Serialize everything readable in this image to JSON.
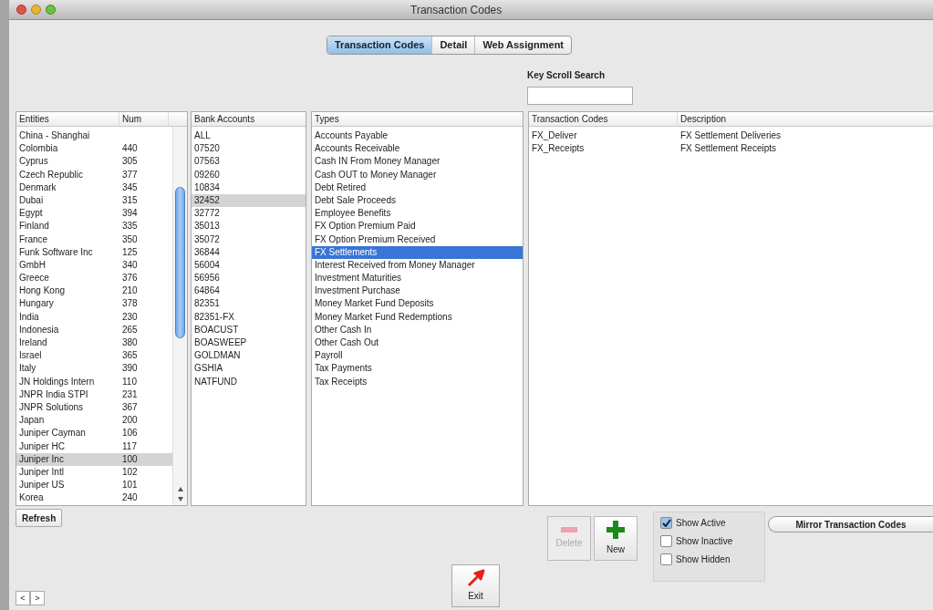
{
  "window": {
    "title": "Transaction Codes"
  },
  "tabs": [
    {
      "label": "Transaction Codes",
      "selected": true
    },
    {
      "label": "Detail",
      "selected": false
    },
    {
      "label": "Web Assignment",
      "selected": false
    }
  ],
  "search": {
    "label": "Key Scroll Search"
  },
  "entities": {
    "columns": [
      "Entities",
      "Num"
    ],
    "rows": [
      {
        "name": "China - Shanghai",
        "num": "",
        "selected": false
      },
      {
        "name": "Colombia",
        "num": "440",
        "selected": false
      },
      {
        "name": "Cyprus",
        "num": "305",
        "selected": false
      },
      {
        "name": "Czech Republic",
        "num": "377",
        "selected": false
      },
      {
        "name": "Denmark",
        "num": "345",
        "selected": false
      },
      {
        "name": "Dubai",
        "num": "315",
        "selected": false
      },
      {
        "name": "Egypt",
        "num": "394",
        "selected": false
      },
      {
        "name": "Finland",
        "num": "335",
        "selected": false
      },
      {
        "name": "France",
        "num": "350",
        "selected": false
      },
      {
        "name": "Funk Software Inc",
        "num": "125",
        "selected": false
      },
      {
        "name": "GmbH",
        "num": "340",
        "selected": false
      },
      {
        "name": "Greece",
        "num": "376",
        "selected": false
      },
      {
        "name": "Hong Kong",
        "num": "210",
        "selected": false
      },
      {
        "name": "Hungary",
        "num": "378",
        "selected": false
      },
      {
        "name": "India",
        "num": "230",
        "selected": false
      },
      {
        "name": "Indonesia",
        "num": "265",
        "selected": false
      },
      {
        "name": "Ireland",
        "num": "380",
        "selected": false
      },
      {
        "name": "Israel",
        "num": "365",
        "selected": false
      },
      {
        "name": "Italy",
        "num": "390",
        "selected": false
      },
      {
        "name": "JN Holdings Intern",
        "num": "110",
        "selected": false
      },
      {
        "name": "JNPR India STPI",
        "num": "231",
        "selected": false
      },
      {
        "name": "JNPR Solutions",
        "num": "367",
        "selected": false
      },
      {
        "name": "Japan",
        "num": "200",
        "selected": false
      },
      {
        "name": "Juniper Cayman",
        "num": "106",
        "selected": false
      },
      {
        "name": "Juniper HC",
        "num": "117",
        "selected": false
      },
      {
        "name": "Juniper Inc",
        "num": "100",
        "selected": true
      },
      {
        "name": "Juniper Intl",
        "num": "102",
        "selected": false
      },
      {
        "name": "Juniper US",
        "num": "101",
        "selected": false
      },
      {
        "name": "Korea",
        "num": "240",
        "selected": false
      }
    ]
  },
  "bank_accounts": {
    "column": "Bank Accounts",
    "rows": [
      {
        "label": "ALL",
        "selected": false
      },
      {
        "label": "07520",
        "selected": false
      },
      {
        "label": "07563",
        "selected": false
      },
      {
        "label": "09260",
        "selected": false
      },
      {
        "label": "10834",
        "selected": false
      },
      {
        "label": "32452",
        "selected": true
      },
      {
        "label": "32772",
        "selected": false
      },
      {
        "label": "35013",
        "selected": false
      },
      {
        "label": "35072",
        "selected": false
      },
      {
        "label": "36844",
        "selected": false
      },
      {
        "label": "56004",
        "selected": false
      },
      {
        "label": "56956",
        "selected": false
      },
      {
        "label": "64864",
        "selected": false
      },
      {
        "label": "82351",
        "selected": false
      },
      {
        "label": "82351-FX",
        "selected": false
      },
      {
        "label": "BOACUST",
        "selected": false
      },
      {
        "label": "BOASWEEP",
        "selected": false
      },
      {
        "label": "GOLDMAN",
        "selected": false
      },
      {
        "label": "GSHIA",
        "selected": false
      },
      {
        "label": "NATFUND",
        "selected": false
      }
    ]
  },
  "types": {
    "column": "Types",
    "rows": [
      {
        "label": "Accounts Payable",
        "selected": false
      },
      {
        "label": "Accounts Receivable",
        "selected": false
      },
      {
        "label": "Cash IN From Money Manager",
        "selected": false
      },
      {
        "label": "Cash OUT to Money Manager",
        "selected": false
      },
      {
        "label": "Debt Retired",
        "selected": false
      },
      {
        "label": "Debt Sale Proceeds",
        "selected": false
      },
      {
        "label": "Employee Benefits",
        "selected": false
      },
      {
        "label": "FX Option Premium Paid",
        "selected": false
      },
      {
        "label": "FX Option Premium Received",
        "selected": false
      },
      {
        "label": "FX Settlements",
        "selected": true
      },
      {
        "label": "Interest Received from Money Manager",
        "selected": false
      },
      {
        "label": "Investment Maturities",
        "selected": false
      },
      {
        "label": "Investment Purchase",
        "selected": false
      },
      {
        "label": "Money Market Fund Deposits",
        "selected": false
      },
      {
        "label": "Money Market Fund Redemptions",
        "selected": false
      },
      {
        "label": "Other Cash In",
        "selected": false
      },
      {
        "label": "Other Cash Out",
        "selected": false
      },
      {
        "label": "Payroll",
        "selected": false
      },
      {
        "label": "Tax Payments",
        "selected": false
      },
      {
        "label": "Tax Receipts",
        "selected": false
      }
    ]
  },
  "codes": {
    "columns": [
      "Transaction Codes",
      "Description"
    ],
    "rows": [
      {
        "code": "FX_Deliver",
        "description": "FX Settlement Deliveries"
      },
      {
        "code": "FX_Receipts",
        "description": "FX Settlement Receipts"
      }
    ]
  },
  "refresh_button": "Refresh",
  "delete_button": {
    "label": "Delete",
    "disabled": true
  },
  "new_button": {
    "label": "New",
    "disabled": false
  },
  "filters": [
    {
      "label": "Show Active",
      "checked": true
    },
    {
      "label": "Show Inactive",
      "checked": false
    },
    {
      "label": "Show Hidden",
      "checked": false
    }
  ],
  "mirror_button": "Mirror Transaction Codes",
  "exit_button": "Exit",
  "nav": [
    "<",
    ">"
  ]
}
